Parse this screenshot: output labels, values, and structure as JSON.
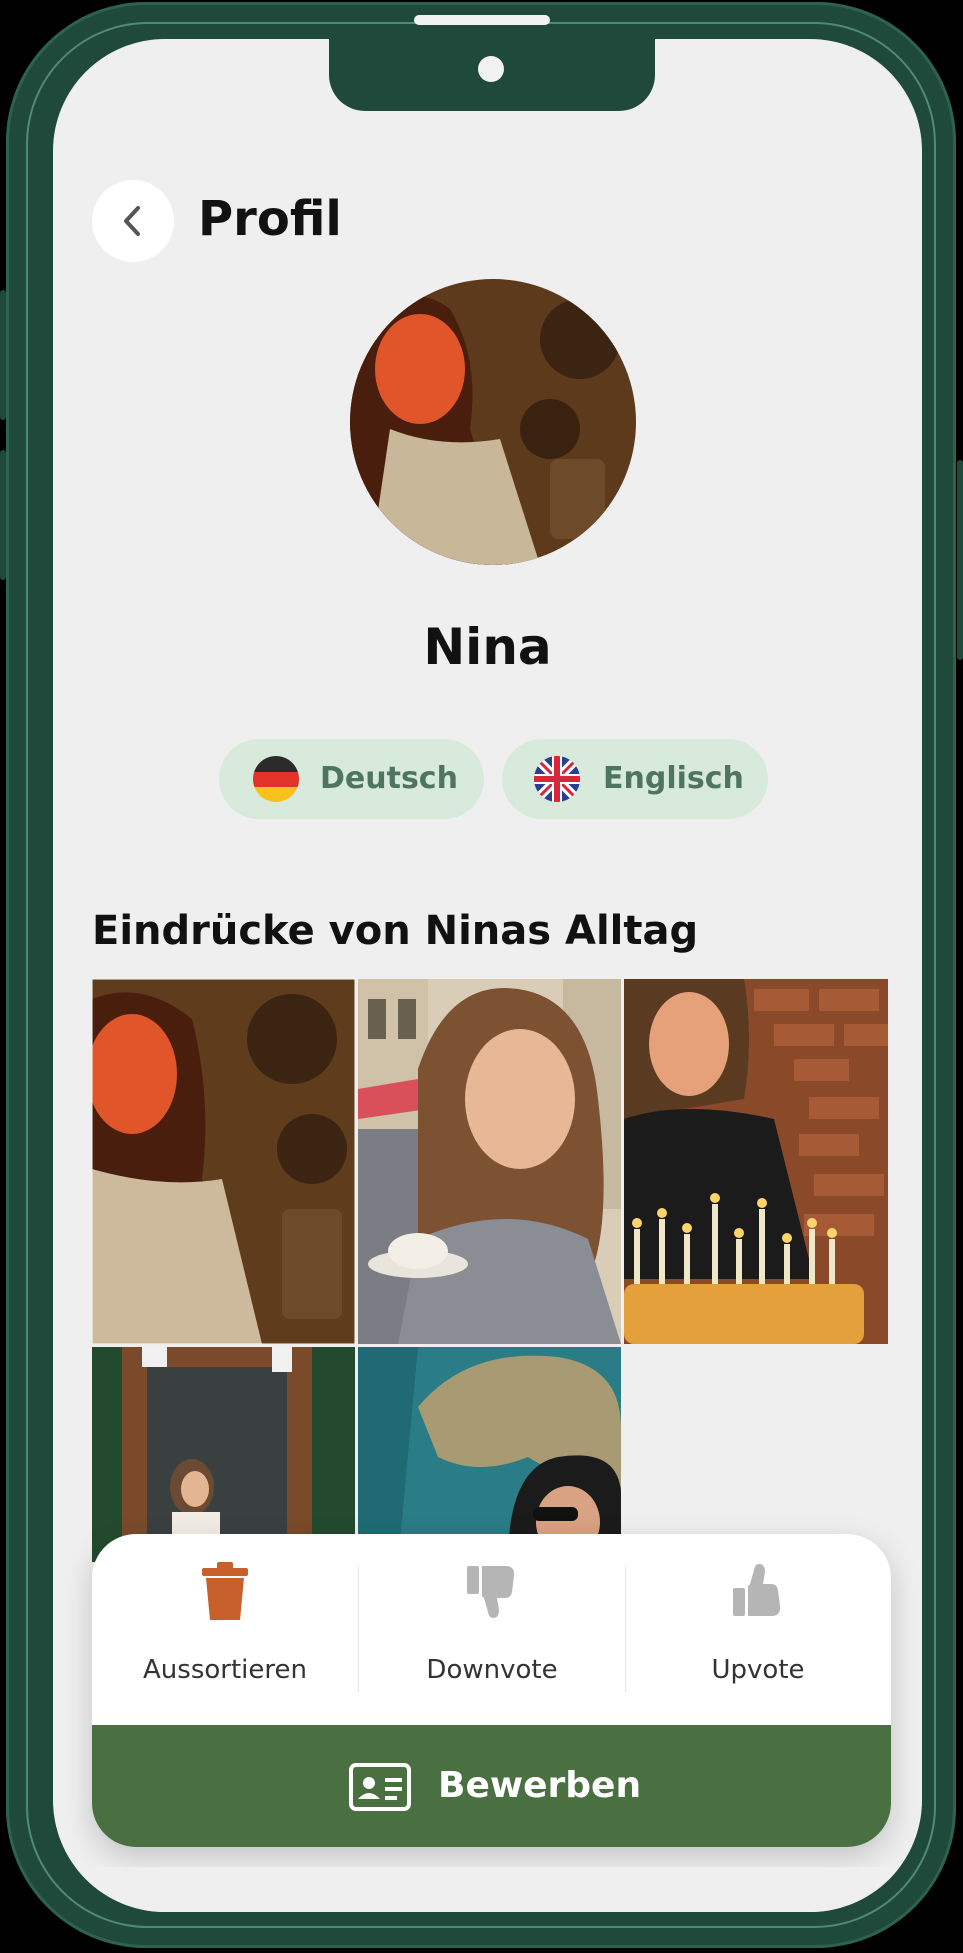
{
  "header": {
    "title": "Profil",
    "back_icon": "chevron-left-icon"
  },
  "profile": {
    "name": "Nina",
    "languages": [
      {
        "label": "Deutsch",
        "flag": "germany-flag-icon"
      },
      {
        "label": "Englisch",
        "flag": "uk-flag-icon"
      }
    ]
  },
  "gallery": {
    "title": "Eindrücke von Ninas Alltag",
    "photo_count_visible": 5
  },
  "actions": {
    "discard": {
      "label": "Aussortieren",
      "icon": "trash-icon",
      "color": "#c8602c"
    },
    "downvote": {
      "label": "Downvote",
      "icon": "thumbs-down-icon",
      "color": "#b5b5b5"
    },
    "upvote": {
      "label": "Upvote",
      "icon": "thumbs-up-icon",
      "color": "#b5b5b5"
    }
  },
  "apply": {
    "label": "Bewerben",
    "icon": "id-card-icon",
    "color": "#4a7042"
  },
  "colors": {
    "device_frame": "#1f4a3b",
    "pill_bg": "#d7eadb",
    "pill_text": "#4f7561",
    "screen_bg": "#efefef"
  }
}
